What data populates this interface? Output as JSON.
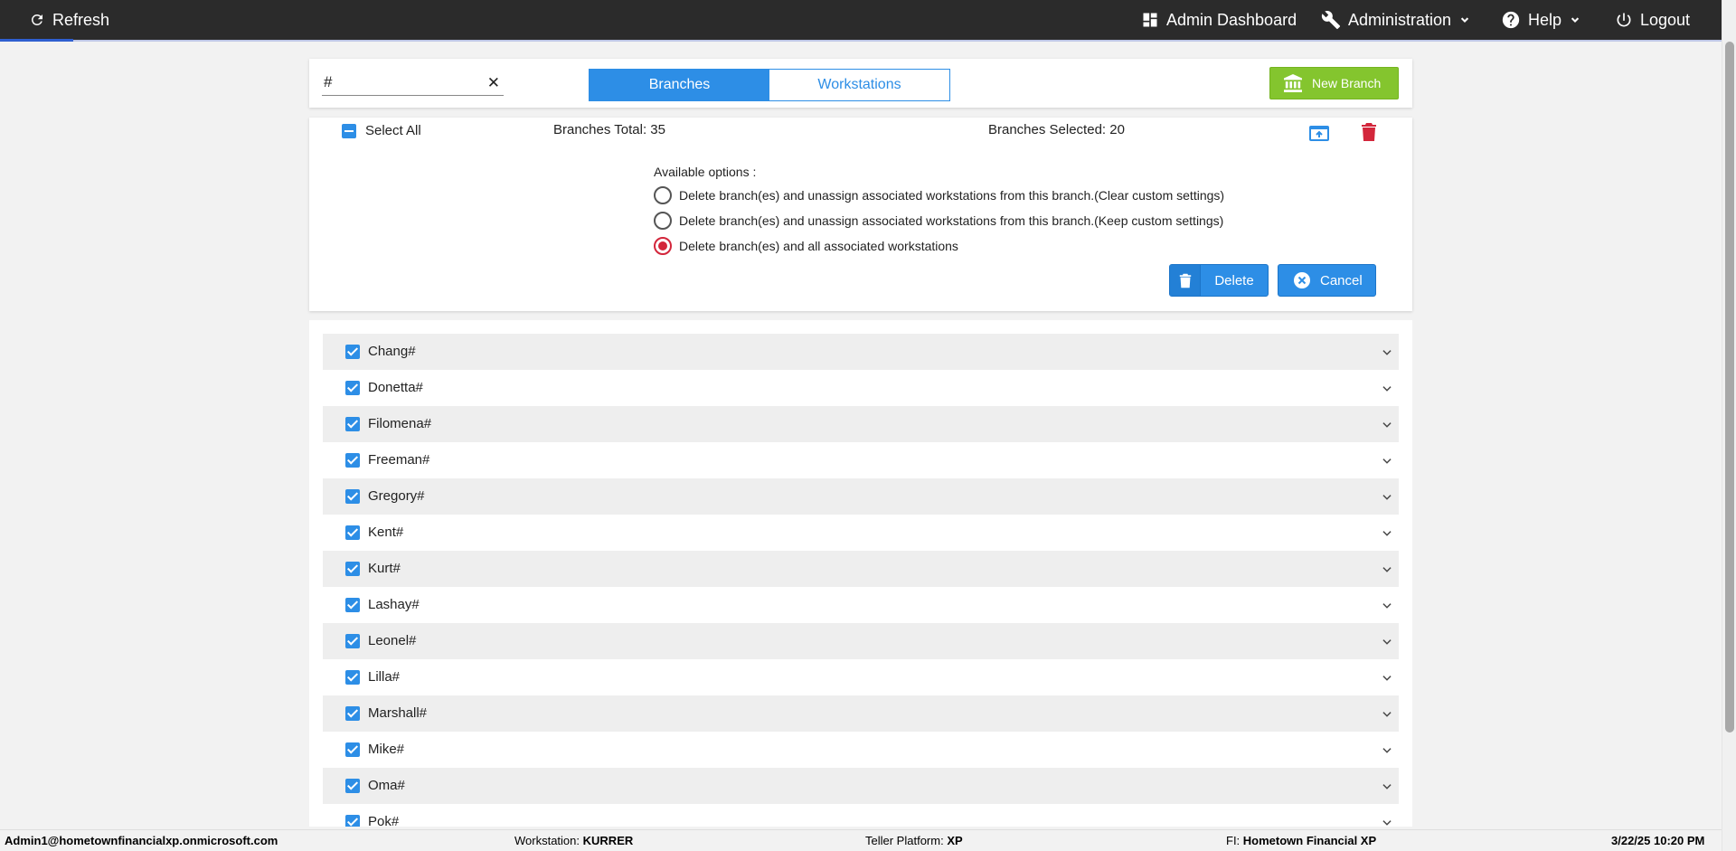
{
  "topbar": {
    "refresh_label": "Refresh",
    "admin_dashboard_label": "Admin Dashboard",
    "administration_label": "Administration",
    "help_label": "Help",
    "logout_label": "Logout"
  },
  "toolbar": {
    "search_value": "#",
    "clear_symbol": "✕",
    "tabs": [
      {
        "label": "Branches",
        "active": true
      },
      {
        "label": "Workstations",
        "active": false
      }
    ],
    "new_branch_label": "New Branch"
  },
  "bulk": {
    "select_all_label": "Select All",
    "total_label": "Branches Total: 35",
    "selected_label": "Branches Selected: 20",
    "available_options_label": "Available options :",
    "options": [
      {
        "label": "Delete branch(es) and unassign associated workstations from this branch.(Clear custom settings)",
        "checked": false
      },
      {
        "label": "Delete branch(es) and unassign associated workstations from this branch.(Keep custom settings)",
        "checked": false
      },
      {
        "label": "Delete branch(es) and all associated workstations",
        "checked": true
      }
    ],
    "delete_label": "Delete",
    "cancel_label": "Cancel"
  },
  "branches": [
    {
      "name": "Chang#",
      "checked": true
    },
    {
      "name": "Donetta#",
      "checked": true
    },
    {
      "name": "Filomena#",
      "checked": true
    },
    {
      "name": "Freeman#",
      "checked": true
    },
    {
      "name": "Gregory#",
      "checked": true
    },
    {
      "name": "Kent#",
      "checked": true
    },
    {
      "name": "Kurt#",
      "checked": true
    },
    {
      "name": "Lashay#",
      "checked": true
    },
    {
      "name": "Leonel#",
      "checked": true
    },
    {
      "name": "Lilla#",
      "checked": true
    },
    {
      "name": "Marshall#",
      "checked": true
    },
    {
      "name": "Mike#",
      "checked": true
    },
    {
      "name": "Oma#",
      "checked": true
    },
    {
      "name": "Pok#",
      "checked": true
    }
  ],
  "footer": {
    "user": "Admin1@hometownfinancialxp.onmicrosoft.com",
    "workstation_label": "Workstation:",
    "workstation_value": "KURRER",
    "platform_label": "Teller Platform:",
    "platform_value": "XP",
    "fi_label": "FI:",
    "fi_value": "Hometown Financial XP",
    "datetime": "3/22/25 10:20 PM"
  },
  "colors": {
    "accent": "#2d8ee6",
    "new_branch": "#84c52e",
    "danger": "#d3263b",
    "topbar": "#2b2b2b"
  }
}
